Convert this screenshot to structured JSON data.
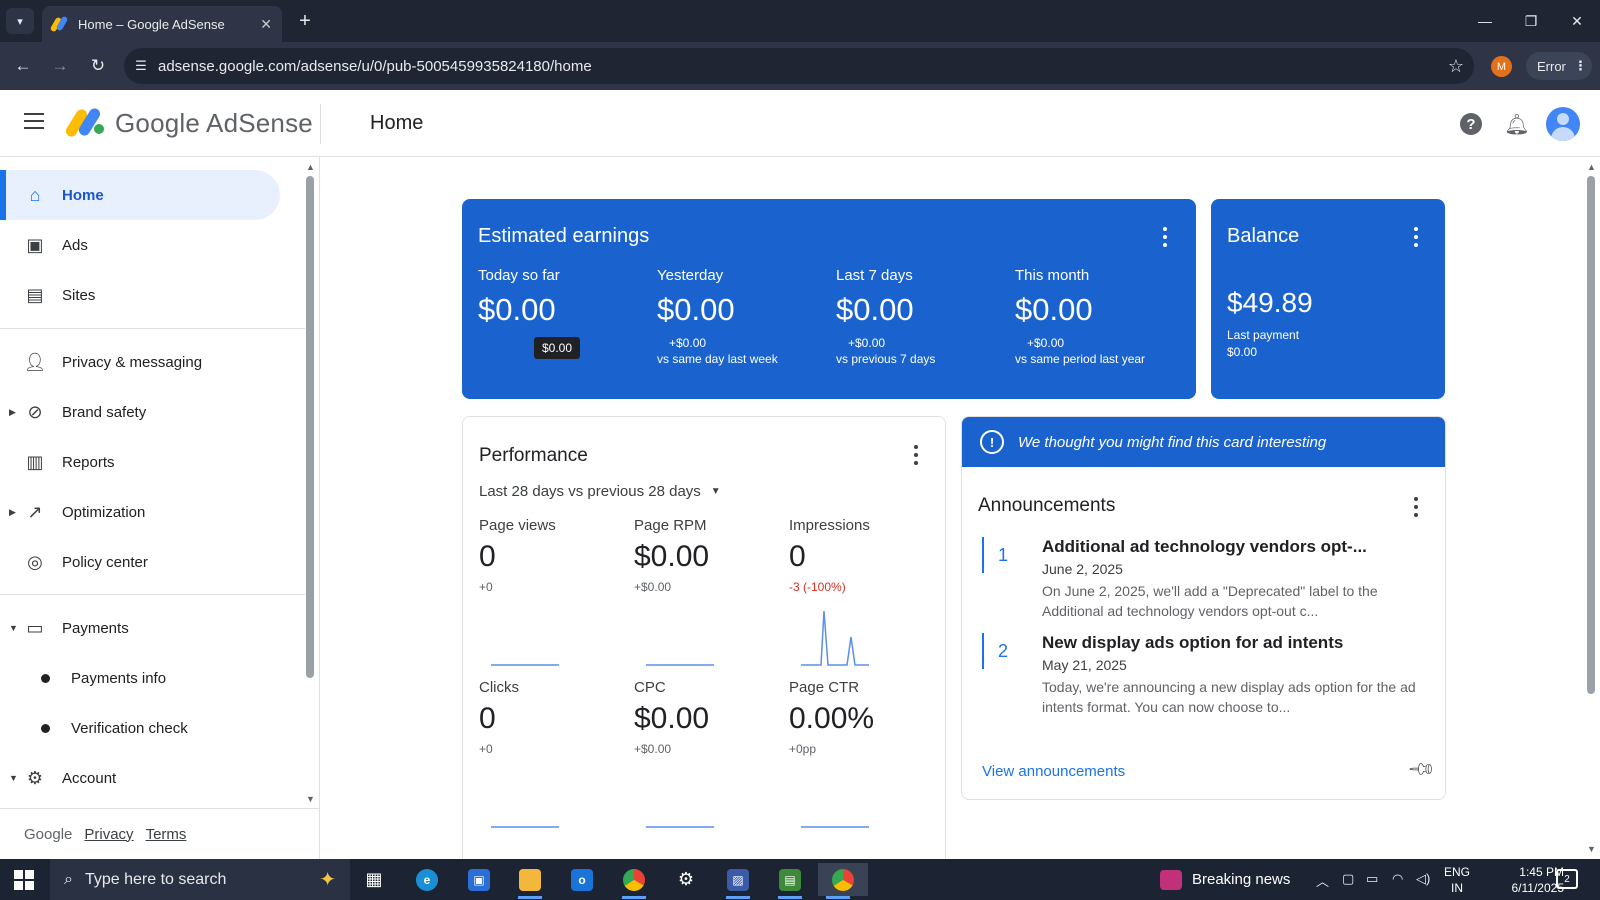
{
  "browser": {
    "tab_title": "Home – Google AdSense",
    "url": "adsense.google.com/adsense/u/0/pub-5005459935824180/home",
    "profile_initial": "M",
    "error_label": "Error"
  },
  "header": {
    "brand": "Google AdSense",
    "page_title": "Home"
  },
  "sidebar": {
    "items": [
      {
        "label": "Home",
        "icon": "home-icon"
      },
      {
        "label": "Ads",
        "icon": "ads-icon"
      },
      {
        "label": "Sites",
        "icon": "sites-icon"
      },
      {
        "label": "Privacy & messaging",
        "icon": "privacy-icon"
      },
      {
        "label": "Brand safety",
        "icon": "block-icon"
      },
      {
        "label": "Reports",
        "icon": "bar-chart-icon"
      },
      {
        "label": "Optimization",
        "icon": "trending-icon"
      },
      {
        "label": "Policy center",
        "icon": "policy-icon"
      },
      {
        "label": "Payments",
        "icon": "payments-icon"
      },
      {
        "label": "Payments info"
      },
      {
        "label": "Verification check"
      },
      {
        "label": "Account",
        "icon": "gear-icon"
      }
    ],
    "footer": {
      "google": "Google",
      "privacy": "Privacy",
      "terms": "Terms"
    }
  },
  "earnings": {
    "title": "Estimated earnings",
    "today": {
      "label": "Today so far",
      "value": "$0.00",
      "tooltip": "$0.00"
    },
    "yesterday": {
      "label": "Yesterday",
      "value": "$0.00",
      "change": "+$0.00",
      "compare": "vs same day last week"
    },
    "last7": {
      "label": "Last 7 days",
      "value": "$0.00",
      "change": "+$0.00",
      "compare": "vs previous 7 days"
    },
    "month": {
      "label": "This month",
      "value": "$0.00",
      "change": "+$0.00",
      "compare": "vs same period last year"
    }
  },
  "balance": {
    "title": "Balance",
    "amount": "$49.89",
    "last_payment_label": "Last payment",
    "last_payment_value": "$0.00"
  },
  "performance": {
    "title": "Performance",
    "range": "Last 28 days vs previous 28 days",
    "metrics": [
      {
        "label": "Page views",
        "value": "0",
        "change": "+0"
      },
      {
        "label": "Page RPM",
        "value": "$0.00",
        "change": "+$0.00"
      },
      {
        "label": "Impressions",
        "value": "0",
        "change": "-3 (-100%)"
      },
      {
        "label": "Clicks",
        "value": "0",
        "change": "+0"
      },
      {
        "label": "CPC",
        "value": "$0.00",
        "change": "+$0.00"
      },
      {
        "label": "Page CTR",
        "value": "0.00%",
        "change": "+0pp"
      }
    ]
  },
  "announcements": {
    "banner": "We thought you might find this card interesting",
    "title": "Announcements",
    "items": [
      {
        "num": "1",
        "title": "Additional ad technology vendors opt-...",
        "date": "June 2, 2025",
        "text": "On June 2, 2025, we'll add a \"Deprecated\" label to the Additional ad technology vendors opt-out c..."
      },
      {
        "num": "2",
        "title": "New display ads option for ad intents",
        "date": "May 21, 2025",
        "text": "Today, we're announcing a new display ads option for the ad intents format. You can now choose to..."
      }
    ],
    "view_link": "View announcements"
  },
  "taskbar": {
    "search_placeholder": "Type here to search",
    "news": "Breaking news",
    "lang1": "ENG",
    "lang2": "IN",
    "time": "1:45 PM",
    "date": "6/11/2025",
    "notif_count": "2"
  },
  "colors": {
    "brand_blue": "#1a63cf",
    "accent": "#1a73e8",
    "negative": "#d93025"
  }
}
